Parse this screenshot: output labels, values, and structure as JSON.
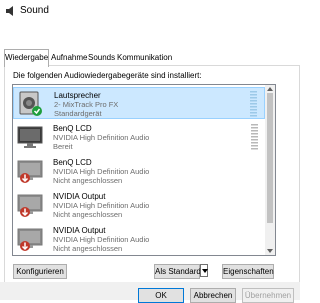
{
  "window": {
    "title": "Sound"
  },
  "tabs": [
    {
      "label": "Wiedergabe",
      "active": true
    },
    {
      "label": "Aufnahme"
    },
    {
      "label": "Sounds"
    },
    {
      "label": "Kommunikation"
    }
  ],
  "intro": "Die folgenden Audiowiedergabegeräte sind installiert:",
  "devices": [
    {
      "name": "Lautsprecher",
      "line1": "2- MixTrack Pro FX",
      "line2": "Standardgerät",
      "icon": "speaker-icon",
      "status": "default-check",
      "selected": true
    },
    {
      "name": "BenQ LCD",
      "line1": "NVIDIA High Definition Audio",
      "line2": "Bereit",
      "icon": "monitor-icon",
      "status": "ready"
    },
    {
      "name": "BenQ LCD",
      "line1": "NVIDIA High Definition Audio",
      "line2": "Nicht angeschlossen",
      "icon": "monitor-icon",
      "status": "unplugged"
    },
    {
      "name": "NVIDIA Output",
      "line1": "NVIDIA High Definition Audio",
      "line2": "Nicht angeschlossen",
      "icon": "monitor-icon",
      "status": "unplugged"
    },
    {
      "name": "NVIDIA Output",
      "line1": "NVIDIA High Definition Audio",
      "line2": "Nicht angeschlossen",
      "icon": "monitor-icon",
      "status": "unplugged"
    }
  ],
  "buttons": {
    "configure": "Konfigurieren",
    "set_default": "Als Standard",
    "properties": "Eigenschaften",
    "ok": "OK",
    "cancel": "Abbrechen",
    "apply": "Übernehmen"
  },
  "colors": {
    "selection": "#cce8ff",
    "accent": "#0078d7",
    "check": "#1e9e3c",
    "unplugged": "#c0392b"
  }
}
